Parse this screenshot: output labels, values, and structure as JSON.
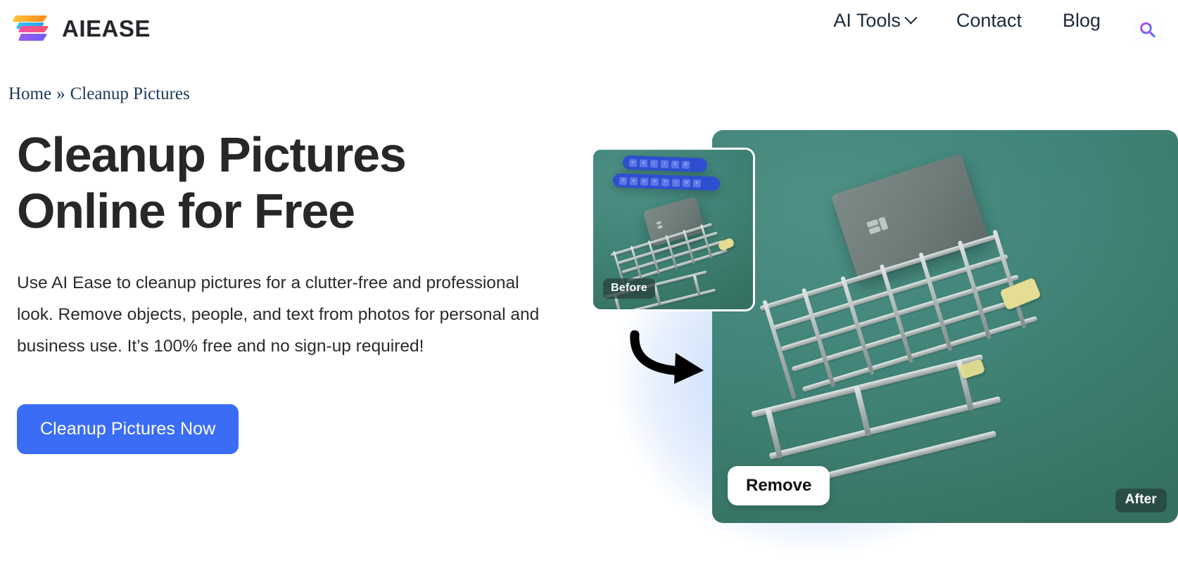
{
  "header": {
    "brand_name": "AIEASE",
    "logo_icon": "aiease-ribbon-logo",
    "nav": [
      {
        "label": "AI Tools",
        "has_dropdown": true,
        "icon": "chevron-down-icon"
      },
      {
        "label": "Contact",
        "has_dropdown": false
      },
      {
        "label": "Blog",
        "has_dropdown": false
      }
    ],
    "search_icon": "search-icon"
  },
  "breadcrumb": {
    "home": "Home",
    "separator": "»",
    "current": "Cleanup Pictures"
  },
  "hero": {
    "title": "Cleanup Pictures\nOnline for Free",
    "description": "Use AI Ease to cleanup pictures for a clutter-free and professional look. Remove objects, people, and text from photos for personal and business use. It’s 100% free and no sign-up required!",
    "cta_label": "Cleanup Pictures Now"
  },
  "showcase": {
    "before_badge": "Before",
    "after_badge": "After",
    "remove_button": "Remove",
    "arrow_icon": "curved-arrow-right-icon",
    "before_tiles_row1": "ONLINE",
    "before_tiles_row2": "SHOPPING"
  },
  "colors": {
    "accent_blue": "#3b6cf6",
    "brand_dark": "#25262b",
    "breadcrumb_navy": "#1b3a5c",
    "photo_teal": "#3f8479",
    "tile_blue": "#2f4fd0",
    "glow_blue": "#bcd7fb"
  }
}
